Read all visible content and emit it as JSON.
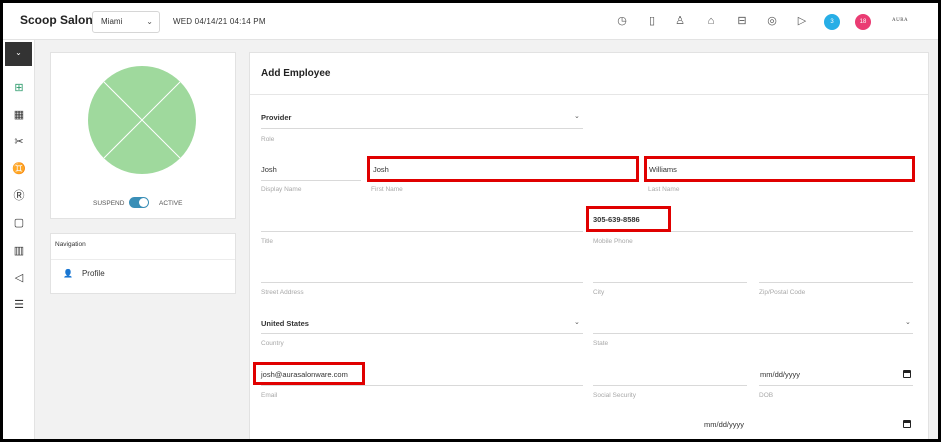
{
  "header": {
    "brand": "Scoop Salon",
    "location": "Miami",
    "datetime": "WED 04/14/21  04:14 PM",
    "icons": [
      "clock-icon",
      "book-icon",
      "crowd-icon",
      "chart-icon",
      "register-icon",
      "lifebuoy-icon",
      "play-icon"
    ],
    "badge_blue": "3",
    "badge_pink": "18",
    "logo": "AURA",
    "colors": {
      "badge_blue": "#27aee6",
      "badge_pink": "#ea3c73"
    }
  },
  "rail": {
    "icons": [
      "add-appointment-icon",
      "calendar-icon",
      "scissors-icon",
      "people-icon",
      "account-icon",
      "register-icon",
      "bar-chart-icon",
      "megaphone-icon",
      "sliders-icon"
    ]
  },
  "profile": {
    "suspend_label": "SUSPEND",
    "active_label": "ACTIVE",
    "navigation_label": "Navigation",
    "nav_profile": "Profile",
    "toggle_on": true,
    "colors": {
      "avatar": "#9fd99d",
      "toggle": "#3a8fb7"
    }
  },
  "form": {
    "title": "Add Employee",
    "role": {
      "value": "Provider",
      "label": "Role"
    },
    "display_name": {
      "value": "Josh",
      "label": "Display Name"
    },
    "first_name": {
      "value": "Josh",
      "label": "First Name"
    },
    "last_name": {
      "value": "Williams",
      "label": "Last Name"
    },
    "title_field": {
      "value": "",
      "label": "Title"
    },
    "mobile_phone": {
      "value": "305-639-8586",
      "label": "Mobile Phone"
    },
    "street_address": {
      "value": "",
      "label": "Street Address"
    },
    "city": {
      "value": "",
      "label": "City"
    },
    "zip": {
      "value": "",
      "label": "Zip/Postal Code"
    },
    "country": {
      "value": "United States",
      "label": "Country"
    },
    "state": {
      "value": "",
      "label": "State"
    },
    "email": {
      "value": "josh@aurasalonware.com",
      "label": "Email"
    },
    "ssn": {
      "value": "",
      "label": "Social Security"
    },
    "dob": {
      "value": "mm/dd/yyyy",
      "label": "DOB"
    },
    "hire_date": {
      "value": "mm/dd/yyyy"
    },
    "colors": {
      "highlight": "#e00000"
    }
  }
}
